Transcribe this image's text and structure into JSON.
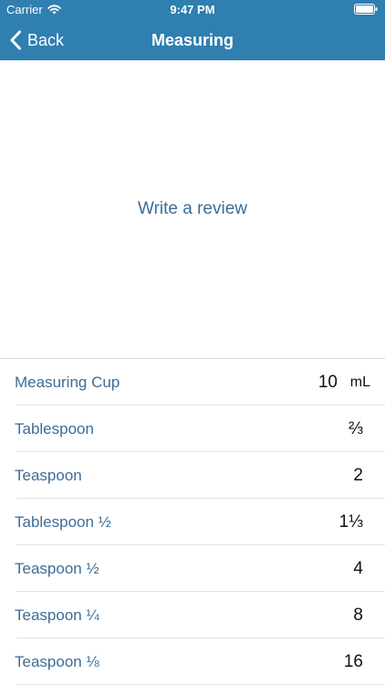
{
  "status_bar": {
    "carrier": "Carrier",
    "time": "9:47 PM",
    "wifi_icon": "wifi-icon",
    "battery_icon": "battery-icon"
  },
  "nav": {
    "back_label": "Back",
    "back_icon": "chevron-left-icon",
    "title": "Measuring"
  },
  "review": {
    "label": "Write a review"
  },
  "rows": [
    {
      "label": "Measuring Cup",
      "value": "10",
      "unit": "mL"
    },
    {
      "label": "Tablespoon",
      "value": "⅔"
    },
    {
      "label": "Teaspoon",
      "value": "2"
    },
    {
      "label": "Tablespoon ½",
      "value": "1⅓"
    },
    {
      "label": "Teaspoon ½",
      "value": "4"
    },
    {
      "label": "Teaspoon ¼",
      "value": "8"
    },
    {
      "label": "Teaspoon ⅛",
      "value": "16"
    }
  ],
  "colors": {
    "header_bg": "#2f7fb0",
    "accent_text": "#3b6d98",
    "value_text": "#111111"
  }
}
